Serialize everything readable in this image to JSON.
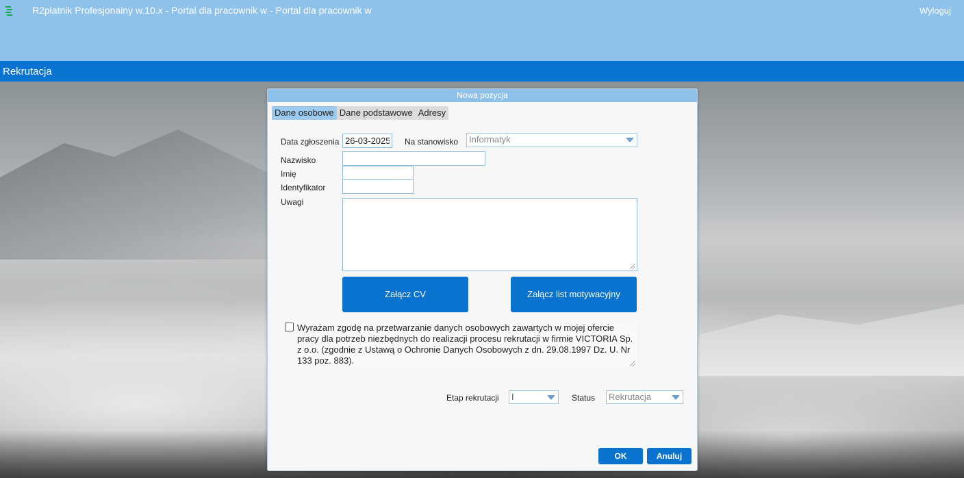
{
  "header": {
    "app_title": "R2płatnik Profesjonalny w.10.x - Portal dla pracownik w - Portal dla pracownik w",
    "logout_label": "Wyloguj",
    "section_title": "Rekrutacja"
  },
  "dialog": {
    "title": "Nowa pozycja",
    "tabs": [
      {
        "label": "Dane osobowe",
        "active": true
      },
      {
        "label": "Dane podstawowe",
        "active": false
      },
      {
        "label": "Adresy",
        "active": false
      }
    ],
    "form": {
      "date_label": "Data zgłoszenia",
      "date_value": "26-03-2025",
      "position_label": "Na stanowisko",
      "position_value": "Informatyk",
      "surname_label": "Nazwisko",
      "surname_value": "",
      "name_label": "Imię",
      "name_value": "",
      "id_label": "Identyfikator",
      "id_value": "",
      "notes_label": "Uwagi",
      "notes_value": ""
    },
    "attach_cv_label": "Załącz CV",
    "attach_letter_label": "Załącz list motywacyjny",
    "consent": {
      "checked": false,
      "text": "Wyrażam zgodę na przetwarzanie danych osobowych zawartych w mojej ofercie pracy dla potrzeb niezbędnych do realizacji procesu rekrutacji w firmie VICTORIA Sp. z o.o. (zgodnie z Ustawą o Ochronie Danych Osobowych z dn. 29.08.1997 Dz. U. Nr 133 poz. 883)."
    },
    "stage_label": "Etap rekrutacji",
    "stage_value": "I",
    "status_label": "Status",
    "status_value": "Rekrutacja",
    "ok_label": "OK",
    "cancel_label": "Anuluj"
  },
  "colors": {
    "header_bg": "#8fc2ea",
    "section_bar_bg": "#0a73d0",
    "button_bg": "#0a73d0",
    "active_tab_bg": "#9ccbef"
  }
}
